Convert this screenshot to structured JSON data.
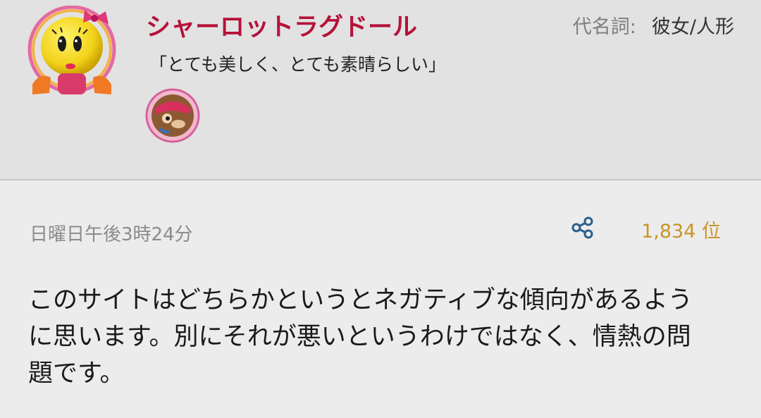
{
  "header": {
    "username": "シャーロットラグドール",
    "pronouns_label": "代名詞:",
    "pronouns_value": "彼女/人形",
    "tagline": "「とても美しく、とても素晴らしい」",
    "avatar_icon": "ms-pacman-avatar-icon",
    "badge_icon": "character-badge-icon"
  },
  "post": {
    "timestamp": "日曜日午後3時24分",
    "rank": "1,834 位",
    "share_icon": "share-icon",
    "body_lines": [
      "このサイトはどちらかというとネガティブな傾向があるよう",
      "に思います。別にそれが悪いというわけではなく、情熱の問",
      "題です。"
    ]
  },
  "colors": {
    "username": "#b5123a",
    "rank": "#c99426",
    "share_icon": "#2b5f8a",
    "header_bg": "#e2e2e2",
    "body_bg": "#ececec"
  }
}
